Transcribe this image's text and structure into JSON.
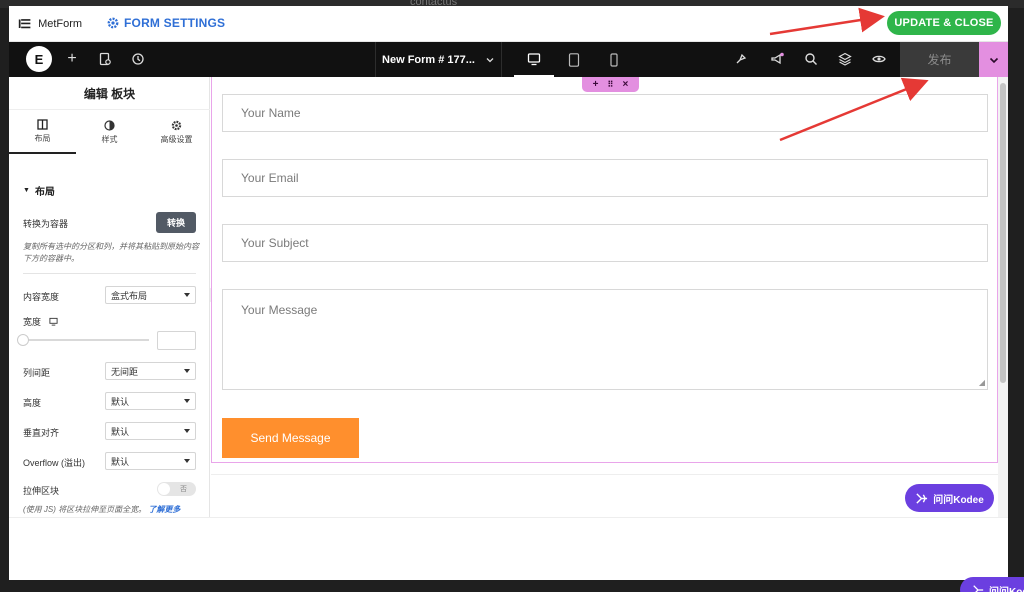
{
  "background": {
    "ghost_text": "contactus"
  },
  "header": {
    "app_name": "MetForm",
    "settings_label": "FORM SETTINGS",
    "update_button": "UPDATE & CLOSE"
  },
  "toolbar": {
    "logo": "E",
    "document_title": "New Form # 177...",
    "publish_label": "发布"
  },
  "panel": {
    "title": "编辑 板块",
    "tabs": [
      {
        "label": "布局"
      },
      {
        "label": "样式"
      },
      {
        "label": "高级设置"
      }
    ],
    "section_title": "布局",
    "convert_label": "转换为容器",
    "convert_button": "转换",
    "hint": "复制所有选中的分区和列，并将其粘贴到原始内容下方的容器中。",
    "content_width_label": "内容宽度",
    "content_width_value": "盒式布局",
    "width_label": "宽度",
    "gap_label": "列间距",
    "gap_value": "无间距",
    "height_label": "高度",
    "height_value": "默认",
    "valign_label": "垂直对齐",
    "valign_value": "默认",
    "overflow_label": "Overflow (溢出)",
    "overflow_value": "默认",
    "stretch_label": "拉伸区块",
    "stretch_toggle": "否",
    "stretch_note": "(使用 JS) 将区块拉伸至页面全宽。",
    "learn_more": "了解更多"
  },
  "form": {
    "name_placeholder": "Your Name",
    "email_placeholder": "Your Email",
    "subject_placeholder": "Your Subject",
    "message_placeholder": "Your Message",
    "submit_label": "Send Message"
  },
  "kodee": {
    "label": "问问Kodee",
    "label_clipped": "问问Kod"
  },
  "colors": {
    "update_green": "#2fb54a",
    "accent_pink": "#e38fe0",
    "submit_orange": "#ff8f2d",
    "kodee_purple": "#6b3fe0",
    "link_blue": "#2f6fd6",
    "arrow_red": "#e53935"
  }
}
